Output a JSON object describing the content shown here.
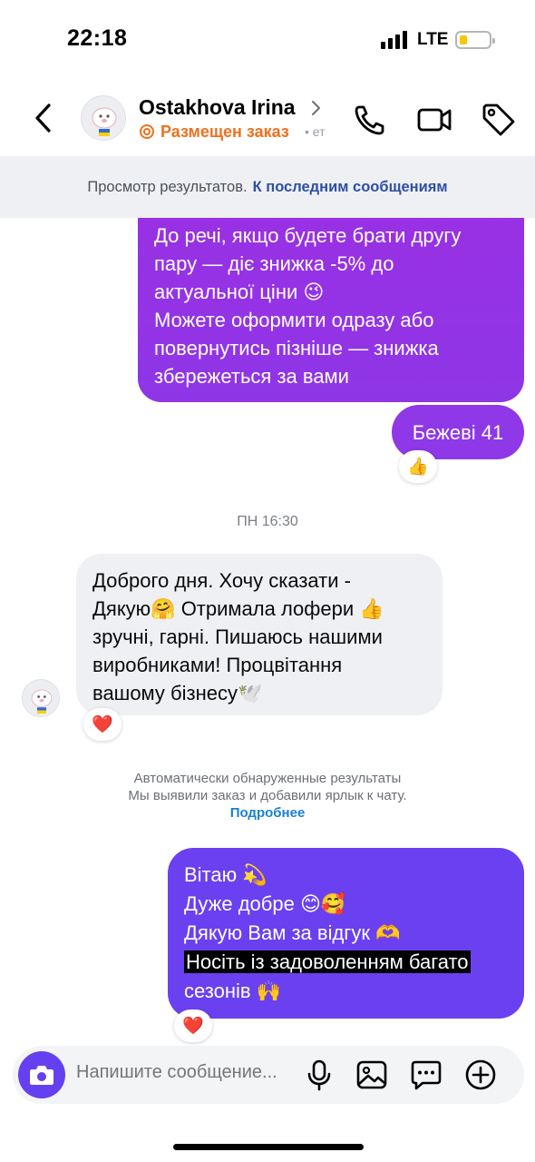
{
  "status_bar": {
    "time": "22:18",
    "network": "LTE",
    "battery_level": 0.25
  },
  "header": {
    "contact_name": "Ostakhova Irina",
    "order_label": "Размещен заказ",
    "order_extra": "• ет"
  },
  "banner": {
    "text": "Просмотр результатов.",
    "link": "К последним сообщениям"
  },
  "messages": {
    "m1": [
      "До речі, якщо будете брати другу",
      "пару — діє знижка -5% до",
      "актуальної ціни 😉",
      "Можете оформити одразу або",
      "повернутись пізніше — знижка",
      "збережеться за вами"
    ],
    "m2": "Бежеві 41",
    "m2_reaction": "👍",
    "timestamp": "ПН 16:30",
    "m3": [
      "Доброго дня. Хочу сказати -",
      "Дякую🤗 Отримала лофери 👍",
      "зручні, гарні. Пишаюсь нашими",
      "виробниками! Процвітання",
      "вашому бізнесу🕊️"
    ],
    "m3_reaction": "❤️",
    "m4": [
      "Вітаю 💫",
      "Дуже добре 😊🥰",
      "Дякую Вам за відгук 🫶",
      "Носіть із задоволенням багато",
      "сезонів 🙌"
    ],
    "m4_reaction": "❤️"
  },
  "auto_info": {
    "line1": "Автоматически обнаруженные результаты",
    "line2": "Мы выявили заказ и добавили ярлык к чату.",
    "link": "Подробнее"
  },
  "composer": {
    "placeholder": "Напишите сообщение..."
  },
  "colors": {
    "outgoing_purple": "#9a30e4",
    "outgoing_violet": "#6a40f0",
    "incoming_gray": "#eff0f3",
    "order_orange": "#f0701e",
    "link_blue": "#2f4fa0"
  },
  "icons": [
    "back-chevron-icon",
    "phone-icon",
    "video-camera-icon",
    "tag-icon",
    "camera-icon",
    "microphone-icon",
    "gallery-icon",
    "sticker-chat-icon",
    "plus-circle-icon"
  ]
}
